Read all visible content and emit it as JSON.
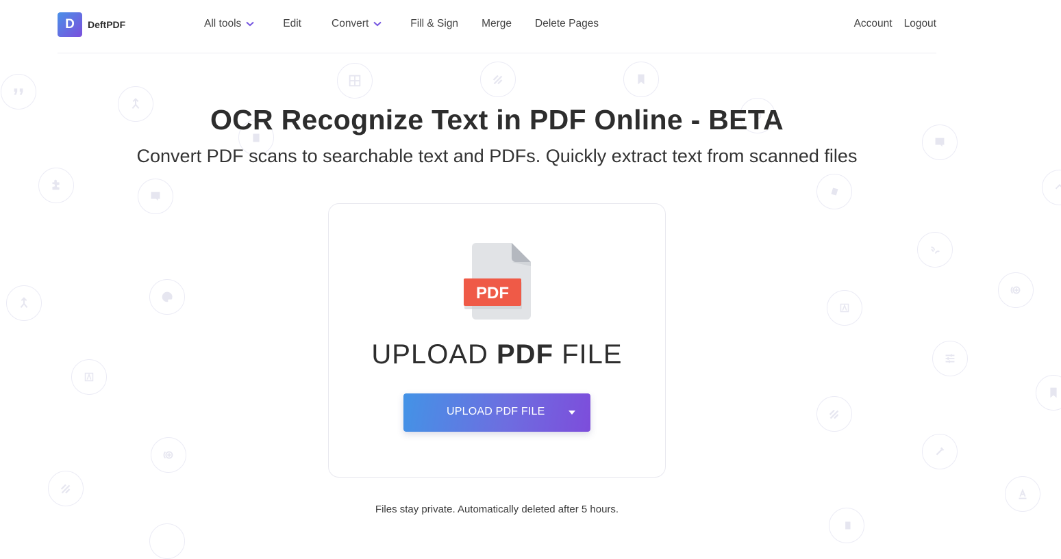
{
  "brand": {
    "logo_letter": "D",
    "name": "DeftPDF"
  },
  "nav": {
    "items": [
      {
        "label": "All tools",
        "has_dropdown": true
      },
      {
        "label": "Edit",
        "has_dropdown": false
      },
      {
        "label": "Convert",
        "has_dropdown": true
      },
      {
        "label": "Fill & Sign",
        "has_dropdown": false
      },
      {
        "label": "Merge",
        "has_dropdown": false
      },
      {
        "label": "Delete Pages",
        "has_dropdown": false
      }
    ],
    "right": [
      {
        "label": "Account"
      },
      {
        "label": "Logout"
      }
    ]
  },
  "hero": {
    "title": "OCR Recognize Text in PDF Online - BETA",
    "subtitle": "Convert PDF scans to searchable text and PDFs. Quickly extract text from scanned files"
  },
  "upload": {
    "file_badge": "PDF",
    "heading_pre": "UPLOAD ",
    "heading_bold": "PDF",
    "heading_post": " FILE",
    "button_label": "UPLOAD PDF FILE"
  },
  "footer_note": "Files stay private. Automatically deleted after 5 hours.",
  "colors": {
    "accent_start": "#4393e6",
    "accent_end": "#7d4ddb",
    "pdf_red": "#ef5a47",
    "text": "#2d2d2d",
    "decor": "#e6e6f0"
  },
  "background_icons": [
    "quote-icon",
    "merge-icon",
    "grid-icon",
    "stripes-icon",
    "bookmark-icon",
    "delete-icon",
    "puzzle-icon",
    "comment-add-icon",
    "crop-icon",
    "comment-add-icon",
    "expand-icon",
    "signal-icon",
    "palette-icon",
    "text-box-icon",
    "add-circle-icon",
    "stripes-icon",
    "sliders-icon",
    "bookmark-icon",
    "eyedropper-icon",
    "text-underline-icon",
    "merge-icon"
  ]
}
